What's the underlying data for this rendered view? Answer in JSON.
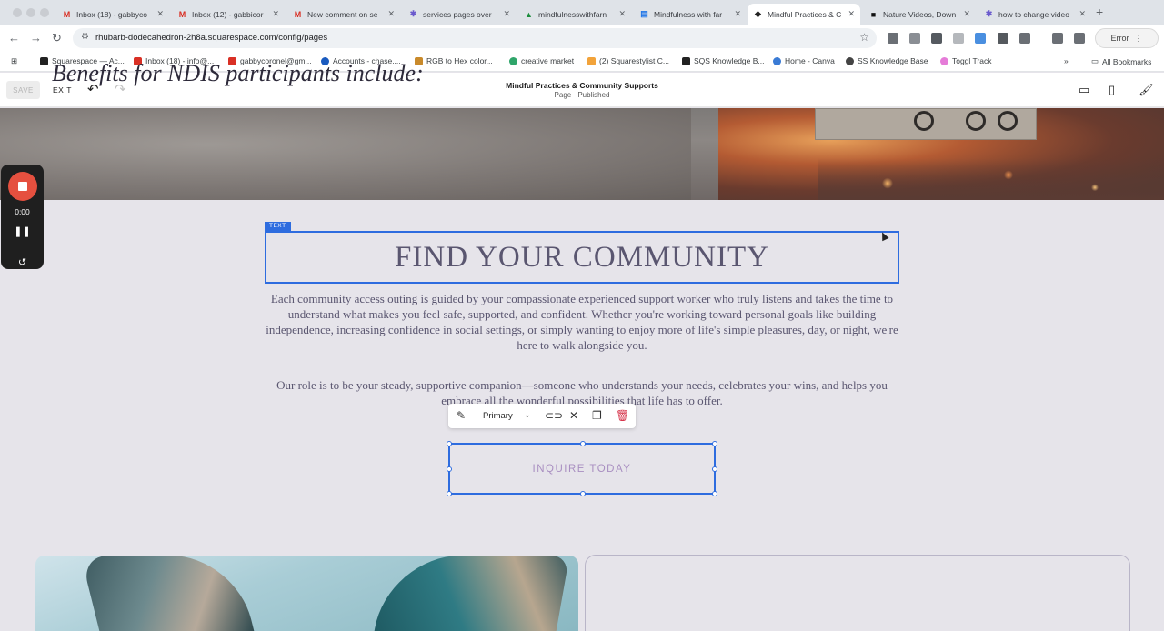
{
  "browser": {
    "tabs": [
      {
        "label": "Inbox (18) - gabbyco",
        "icon": "gmail-icon",
        "icon_color": "#d93025",
        "active": false
      },
      {
        "label": "Inbox (12) - gabbicor",
        "icon": "gmail-icon",
        "icon_color": "#d93025",
        "active": false
      },
      {
        "label": "New comment on se",
        "icon": "gmail-icon",
        "icon_color": "#d93025",
        "active": false
      },
      {
        "label": "services pages over",
        "icon": "asterisk-icon",
        "icon_color": "#6a5acd",
        "active": false
      },
      {
        "label": "mindfulnesswithfarn",
        "icon": "drive-icon",
        "icon_color": "#1e8e3e",
        "active": false
      },
      {
        "label": "Mindfulness with far",
        "icon": "docs-icon",
        "icon_color": "#1a73e8",
        "active": false
      },
      {
        "label": "Mindful Practices & C",
        "icon": "squarespace-icon",
        "icon_color": "#222222",
        "active": true
      },
      {
        "label": "Nature Videos, Down",
        "icon": "pexels-icon",
        "icon_color": "#111111",
        "active": false
      },
      {
        "label": "how to change video",
        "icon": "asterisk-icon",
        "icon_color": "#6a5acd",
        "active": false
      }
    ],
    "url": "rhubarb-dodecahedron-2h8a.squarespace.com/config/pages",
    "error_label": "Error",
    "bookmarks": [
      {
        "label": "Squarespace — Ac...",
        "color": "#222222"
      },
      {
        "label": "Inbox (18) - info@...",
        "color": "#d93025"
      },
      {
        "label": "gabbycoronel@gm...",
        "color": "#d93025"
      },
      {
        "label": "Accounts - chase....",
        "color": "#1a5bbf"
      },
      {
        "label": "RGB to Hex color...",
        "color": "#c98a2b"
      },
      {
        "label": "creative market",
        "color": "#2fa56a"
      },
      {
        "label": "(2) Squarestylist C...",
        "color": "#f2a33a"
      },
      {
        "label": "SQS Knowledge B...",
        "color": "#222222"
      },
      {
        "label": "Home - Canva",
        "color": "#3a7bd5"
      },
      {
        "label": "SS Knowledge Base",
        "color": "#444444"
      },
      {
        "label": "Toggl Track",
        "color": "#e57cd8"
      }
    ],
    "all_bookmarks": "All Bookmarks"
  },
  "editor": {
    "save_label": "SAVE",
    "exit_label": "EXIT",
    "page_title": "Mindful Practices & Community Supports",
    "page_subtitle": "Page · Published"
  },
  "recorder": {
    "time": "0:00"
  },
  "content": {
    "text_block_label": "TEXT",
    "heading": "FIND YOUR COMMUNITY",
    "paragraph1": "Each community access outing is guided by your compassionate experienced support worker who truly listens and takes the time to understand what makes you feel safe, supported, and confident. Whether you're working toward personal goals like building independence, increasing confidence in social settings, or simply wanting to enjoy more of life's simple pleasures, day, or night, we're here to walk alongside you.",
    "paragraph2": "Our role is to be your steady, supportive companion—someone who understands your needs, celebrates your wins, and helps you embrace all the wonderful possibilities that life has to offer.",
    "button_style": "Primary",
    "button_label": "INQUIRE TODAY",
    "benefits_heading": "Benefits for NDIS participants include:"
  },
  "colors": {
    "selection": "#2e6cdf",
    "text": "#5a5670",
    "button_text": "#a98fc1",
    "record": "#e5503f"
  }
}
